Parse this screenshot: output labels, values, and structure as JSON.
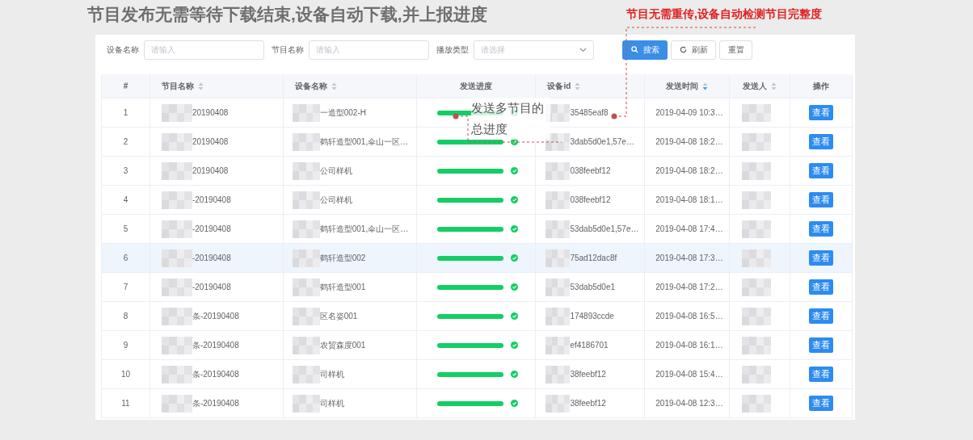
{
  "headline": "节目发布无需等待下载结束,设备自动下载,并上报进度",
  "callouts": {
    "check": "节目无需重传,设备自动检测节目完整度",
    "progress": "发送多节目的总进度"
  },
  "filters": [
    {
      "label": "设备名称",
      "placeholder": "请输入",
      "kind": "input"
    },
    {
      "label": "节目名称",
      "placeholder": "请输入",
      "kind": "input"
    },
    {
      "label": "播放类型",
      "placeholder": "请选择",
      "kind": "select"
    }
  ],
  "buttons": [
    {
      "label": "搜索",
      "kind": "search"
    },
    {
      "label": "刷新",
      "kind": "refresh"
    },
    {
      "label": "重置",
      "kind": "reset"
    }
  ],
  "columns": [
    {
      "label": "#",
      "kind": "plain"
    },
    {
      "label": "节目名称",
      "kind": "sortable"
    },
    {
      "label": "设备名称",
      "kind": "sortable"
    },
    {
      "label": "发送进度",
      "kind": "plain"
    },
    {
      "label": "设备id",
      "kind": "sortable"
    },
    {
      "label": "发送时间",
      "kind": "sorted"
    },
    {
      "label": "发送人",
      "kind": "sortable"
    },
    {
      "label": "操作",
      "kind": "plain"
    }
  ],
  "rows": [
    {
      "index": "1",
      "program": "20190408",
      "device": "一造型002-H",
      "progress": {
        "level": 1,
        "complete": true
      },
      "device_id": "35485eaf8",
      "sent_time": "2019-04-09 10:3…",
      "action": "查看",
      "selected": false
    },
    {
      "index": "2",
      "program": "20190408",
      "device": "鹤轩造型001,伞山一区…",
      "progress": {
        "level": 1,
        "complete": true
      },
      "device_id": "3dab5d0e1,57e…",
      "sent_time": "2019-04-08 18:2…",
      "action": "查看",
      "selected": false
    },
    {
      "index": "3",
      "program": "20190408",
      "device": "公司样机",
      "progress": {
        "level": 1,
        "complete": true
      },
      "device_id": "038feebf12",
      "sent_time": "2019-04-08 18:2…",
      "action": "查看",
      "selected": false
    },
    {
      "index": "4",
      "program": "-20190408",
      "device": "公司样机",
      "progress": {
        "level": 1,
        "complete": true
      },
      "device_id": "038feebf12",
      "sent_time": "2019-04-08 18:1…",
      "action": "查看",
      "selected": false
    },
    {
      "index": "5",
      "program": "-20190408",
      "device": "鹤轩造型001,伞山一区…",
      "progress": {
        "level": 1,
        "complete": true
      },
      "device_id": "53dab5d0e1,57e…",
      "sent_time": "2019-04-08 17:4…",
      "action": "查看",
      "selected": false
    },
    {
      "index": "6",
      "program": "-20190408",
      "device": "鹤轩造型002",
      "progress": {
        "level": 1,
        "complete": true
      },
      "device_id": "75ad12dac8f",
      "sent_time": "2019-04-08 17:3…",
      "action": "查看",
      "selected": true
    },
    {
      "index": "7",
      "program": "-20190408",
      "device": "鹤轩造型001",
      "progress": {
        "level": 1,
        "complete": true
      },
      "device_id": "53dab5d0e1",
      "sent_time": "2019-04-08 17:2…",
      "action": "查看",
      "selected": false
    },
    {
      "index": "8",
      "program": "条-20190408",
      "device": "区名姿001",
      "progress": {
        "level": 1,
        "complete": true
      },
      "device_id": "174893ccde",
      "sent_time": "2019-04-08 16:5…",
      "action": "查看",
      "selected": false
    },
    {
      "index": "9",
      "program": "条-20190408",
      "device": "农贸森度001",
      "progress": {
        "level": 1,
        "complete": true
      },
      "device_id": "ef4186701",
      "sent_time": "2019-04-08 16:1…",
      "action": "查看",
      "selected": false
    },
    {
      "index": "10",
      "program": "条-20190408",
      "device": "司样机",
      "progress": {
        "level": 1,
        "complete": true
      },
      "device_id": "38feebf12",
      "sent_time": "2019-04-08 15:4…",
      "action": "查看",
      "selected": false
    },
    {
      "index": "11",
      "program": "条-20190408",
      "device": "司样机",
      "progress": {
        "level": 1,
        "complete": true
      },
      "device_id": "38feebf12",
      "sent_time": "2019-04-08 12:3…",
      "action": "查看",
      "selected": false
    }
  ]
}
